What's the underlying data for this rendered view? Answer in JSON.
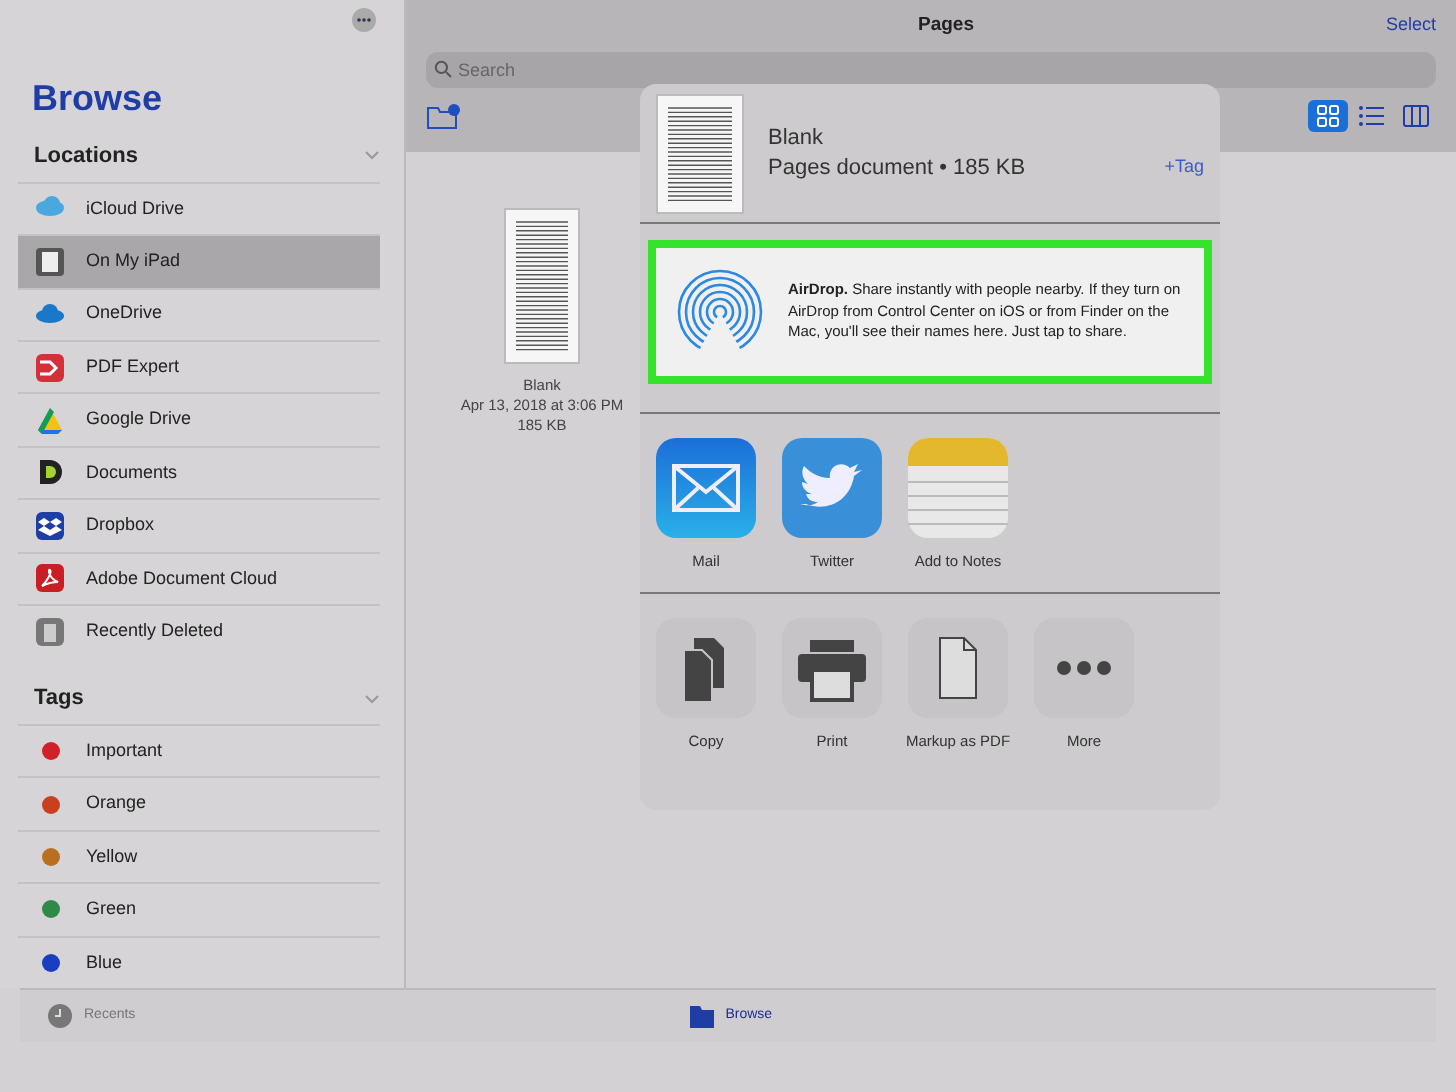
{
  "sidebar": {
    "title": "Browse",
    "locations_heading": "Locations",
    "locations": [
      {
        "label": "iCloud Drive",
        "kind": "icloud",
        "selected": false
      },
      {
        "label": "On My iPad",
        "kind": "ipad",
        "selected": true
      },
      {
        "label": "OneDrive",
        "kind": "onedrive",
        "selected": false
      },
      {
        "label": "PDF Expert",
        "kind": "pdfexpert",
        "selected": false
      },
      {
        "label": "Google Drive",
        "kind": "gdrive",
        "selected": false
      },
      {
        "label": "Documents",
        "kind": "documents",
        "selected": false
      },
      {
        "label": "Dropbox",
        "kind": "dropbox",
        "selected": false
      },
      {
        "label": "Adobe Document Cloud",
        "kind": "adobe",
        "selected": false
      },
      {
        "label": "Recently Deleted",
        "kind": "trash",
        "selected": false
      }
    ],
    "tags_heading": "Tags",
    "tags": [
      {
        "label": "Important",
        "color": "#d0202a"
      },
      {
        "label": "Orange",
        "color": "#c8401e"
      },
      {
        "label": "Yellow",
        "color": "#b8701e"
      },
      {
        "label": "Green",
        "color": "#2e8a46"
      },
      {
        "label": "Blue",
        "color": "#1a3ec0"
      }
    ]
  },
  "main": {
    "title": "Pages",
    "select": "Select",
    "search": {
      "placeholder": "Search"
    },
    "views": [
      {
        "kind": "grid",
        "selected": true
      },
      {
        "kind": "list",
        "selected": false
      },
      {
        "kind": "columns",
        "selected": false
      }
    ],
    "files": [
      {
        "name": "Blank",
        "date": "Apr 13, 2018 at 3:06 PM",
        "size": "185 KB"
      }
    ]
  },
  "share_sheet": {
    "name": "Blank",
    "subtitle": "Pages document • 185 KB",
    "tag_button": "+Tag",
    "airdrop_text": "**AirDrop.** Share instantly with people nearby. If they turn on AirDrop from Control Center on iOS or from Finder on the Mac, you'll see their names here. Just tap to share.",
    "apps": [
      {
        "label": "Mail",
        "kind": "mail"
      },
      {
        "label": "Twitter",
        "kind": "twitter"
      },
      {
        "label": "Add to Notes",
        "kind": "notes"
      }
    ],
    "actions": [
      {
        "label": "Copy",
        "kind": "copy"
      },
      {
        "label": "Print",
        "kind": "print"
      },
      {
        "label": "Markup as PDF",
        "kind": "pdf"
      },
      {
        "label": "More",
        "kind": "more"
      }
    ]
  },
  "tab_bar": [
    {
      "label": "Recents",
      "kind": "recents",
      "selected": false
    },
    {
      "label": "Browse",
      "kind": "browse",
      "selected": true
    }
  ]
}
